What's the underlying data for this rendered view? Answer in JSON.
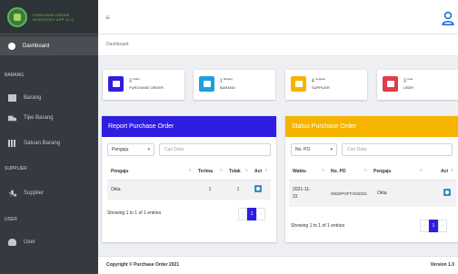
{
  "brand": {
    "line1": "PURCHASE ORDER",
    "line2": "INVENTORY APP V1.0"
  },
  "sidebar": {
    "active": "Dashboard",
    "sections": [
      {
        "header": "BARANG",
        "items": [
          "Barang",
          "Tipe Barang",
          "Satuan Barang"
        ]
      },
      {
        "header": "SUPPLIER",
        "items": [
          "Supplier"
        ]
      },
      {
        "header": "USER",
        "items": [
          "User"
        ]
      }
    ]
  },
  "breadcrumb": "Dashboard",
  "stats": [
    {
      "count": "3",
      "sup": "Order",
      "label": "PURCHASE ORDER",
      "color": "#2f1ee0"
    },
    {
      "count": "1",
      "sup": "Barang",
      "label": "BARANG",
      "color": "#1e9fe0"
    },
    {
      "count": "4",
      "sup": "Supplier",
      "label": "SUPPLIER",
      "color": "#f5b400"
    },
    {
      "count": "3",
      "sup": "User",
      "label": "USER",
      "color": "#e23b4a"
    }
  ],
  "report": {
    "title": "Report Purchase Order",
    "color": "#2f1ee0",
    "select_value": "Pengaju",
    "search_placeholder": "Cari Data",
    "columns": [
      "Pengaju",
      "Terima",
      "Tolak",
      "Act"
    ],
    "rows": [
      {
        "pengaju": "Okta",
        "terima": "1",
        "tolak": "1"
      }
    ],
    "showing": "Showing 1 to 1 of 1 entries",
    "page": "1"
  },
  "status": {
    "title": "Status Purchase Order",
    "color": "#f5b400",
    "select_value": "No. PO",
    "search_placeholder": "Cari Data",
    "columns": [
      "Waktu",
      "No. PO",
      "Pengaju",
      "Act"
    ],
    "rows": [
      {
        "waktu_line1": "2021-11-",
        "waktu_line2": "22",
        "no_po": "0002/POFT/XI/2021",
        "pengaju": "Okta"
      }
    ],
    "showing": "Showing 1 to 1 of 1 entries",
    "page": "1"
  },
  "footer": {
    "copyright": "Copyright © Purchase Order 2021",
    "version": "Version 1.0"
  },
  "icons": {
    "menu": "hamburger-icon",
    "user": "user-circle-icon",
    "dashboard": "dashboard-icon",
    "barang": "box-icon",
    "tipe": "truck-icon",
    "satuan": "grid-icon",
    "supplier": "bar-chart-icon",
    "usernav": "users-icon"
  }
}
